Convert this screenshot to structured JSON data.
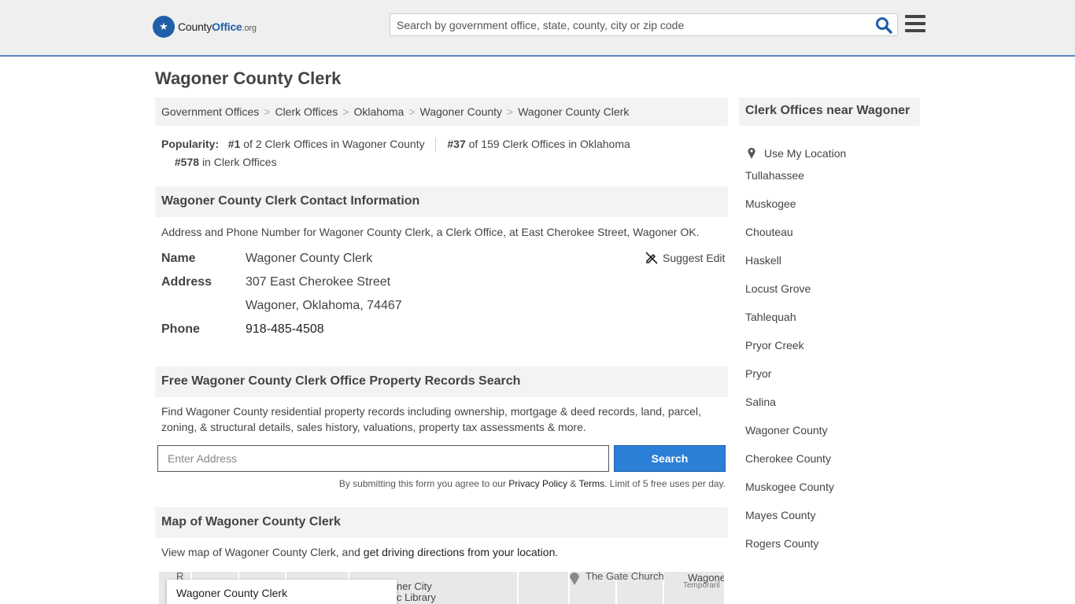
{
  "header": {
    "logo_name": "County",
    "logo_brand": "Office",
    "logo_tld": ".org",
    "search_placeholder": "Search by government office, state, county, city or zip code"
  },
  "page": {
    "title": "Wagoner County Clerk"
  },
  "breadcrumb": [
    "Government Offices",
    "Clerk Offices",
    "Oklahoma",
    "Wagoner County",
    "Wagoner County Clerk"
  ],
  "popularity": {
    "label": "Popularity:",
    "r1_rank": "#1",
    "r1_text": "of 2 Clerk Offices in Wagoner County",
    "r2_rank": "#37",
    "r2_text": "of 159 Clerk Offices in Oklahoma",
    "r3_rank": "#578",
    "r3_text": "in Clerk Offices"
  },
  "contact": {
    "heading": "Wagoner County Clerk Contact Information",
    "desc": "Address and Phone Number for Wagoner County Clerk, a Clerk Office, at East Cherokee Street, Wagoner OK.",
    "name_label": "Name",
    "name_value": "Wagoner County Clerk",
    "address_label": "Address",
    "address_line1": "307 East Cherokee Street",
    "address_line2": "Wagoner, Oklahoma, 74467",
    "phone_label": "Phone",
    "phone_value": "918-485-4508",
    "suggest_edit": "Suggest Edit"
  },
  "records": {
    "heading": "Free Wagoner County Clerk Office Property Records Search",
    "desc": "Find Wagoner County residential property records including ownership, mortgage & deed records, land, parcel, zoning, & structural details, sales history, valuations, property tax assessments & more.",
    "input_placeholder": "Enter Address",
    "button": "Search",
    "terms_prefix": "By submitting this form you agree to our",
    "privacy": "Privacy Policy",
    "amp": "&",
    "terms": "Terms",
    "terms_suffix": ". Limit of 5 free uses per day."
  },
  "map": {
    "heading": "Map of Wagoner County Clerk",
    "desc_prefix": "View map of Wagoner County Clerk, and",
    "desc_link": "get driving directions from your location",
    "desc_suffix": ".",
    "card_title": "Wagoner County Clerk",
    "label_library1": "ner City",
    "label_library2": "c Library",
    "label_church": "The Gate Church",
    "label_wagoner": "Wagone",
    "label_temp": "Temporaril",
    "label_edge": "R"
  },
  "sidebar": {
    "heading": "Clerk Offices near Wagoner",
    "use_location": "Use My Location",
    "items": [
      "Tullahassee",
      "Muskogee",
      "Chouteau",
      "Haskell",
      "Locust Grove",
      "Tahlequah",
      "Pryor Creek",
      "Pryor",
      "Salina",
      "Wagoner County",
      "Cherokee County",
      "Muskogee County",
      "Mayes County",
      "Rogers County"
    ]
  },
  "colors": {
    "accent": "#1f5fa8",
    "button": "#2c7fd6",
    "panel": "#f3f3f3"
  }
}
